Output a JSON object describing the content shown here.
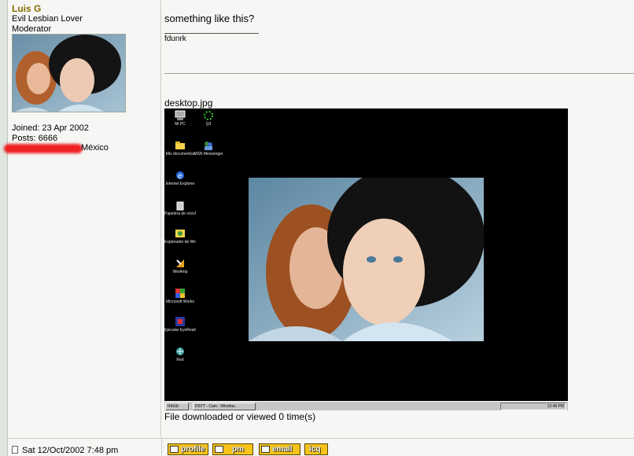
{
  "user": {
    "name": "Luis G",
    "title": "Evil Lesbian Lover",
    "rank": "Moderator",
    "joined": "Joined: 23 Apr 2002",
    "posts": "Posts: 6666",
    "location": "México"
  },
  "post": {
    "text": "something like this?",
    "signature": "fdunrk",
    "attachment_name": "desktop.jpg",
    "file_stats": "File downloaded or viewed 0 time(s)",
    "timestamp": "Sat 12/Oct/2002 7:48 pm"
  },
  "desktop": {
    "icons": [
      {
        "label": "Mi PC",
        "icon": "computer-icon"
      },
      {
        "label": "Q3",
        "icon": "game-icon"
      },
      {
        "label": "Mis documentos",
        "icon": "folder-icon"
      },
      {
        "label": "MSN Messenger",
        "icon": "messenger-icon"
      },
      {
        "label": "Internet Explorer",
        "icon": "ie-icon"
      },
      {
        "label": "Papelera de reciclaje",
        "icon": "recycle-bin-icon"
      },
      {
        "label": "Explorador de Windows",
        "icon": "explorer-icon"
      },
      {
        "label": "WinAmp",
        "icon": "winamp-icon"
      },
      {
        "label": "Microsoft Works",
        "icon": "works-icon"
      },
      {
        "label": "Ejecutar EyeRealize",
        "icon": "app-icon"
      },
      {
        "label": "Red",
        "icon": "network-icon"
      }
    ],
    "start_label": "Inicio",
    "task_label": "DSTT - Cam - Window...",
    "tray_text": "12:48 PM"
  },
  "buttons": {
    "profile": "profile",
    "pm": "pm",
    "email": "email",
    "icq": "icq"
  }
}
